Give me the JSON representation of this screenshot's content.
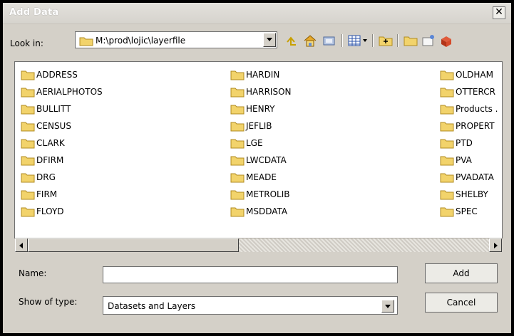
{
  "window": {
    "title": "Add Data",
    "close_glyph": "✕"
  },
  "look_in": {
    "label": "Look in:",
    "path": "M:\\prod\\lojic\\layerfile"
  },
  "toolbar": [
    {
      "name": "up-one-level-icon"
    },
    {
      "name": "home-icon"
    },
    {
      "name": "connect-to-folder-icon"
    },
    {
      "name": "view-menu-icon"
    },
    {
      "name": "new-folder-icon"
    },
    {
      "name": "new-folder-2-icon"
    },
    {
      "name": "new-shapefile-icon"
    },
    {
      "name": "new-toolbox-icon"
    }
  ],
  "files": {
    "col1": [
      "ADDRESS",
      "AERIALPHOTOS",
      "BULLITT",
      "CENSUS",
      "CLARK",
      "DFIRM",
      "DRG",
      "FIRM",
      "FLOYD"
    ],
    "col2": [
      "HARDIN",
      "HARRISON",
      "HENRY",
      "JEFLIB",
      "LGE",
      "LWCDATA",
      "MEADE",
      "METROLIB",
      "MSDDATA"
    ],
    "col3": [
      "OLDHAM",
      "OTTERCR",
      "Products .",
      "PROPERT",
      "PTD",
      "PVA",
      "PVADATA",
      "SHELBY",
      "SPEC"
    ]
  },
  "name": {
    "label": "Name:",
    "value": ""
  },
  "type": {
    "label": "Show of type:",
    "value": "Datasets and Layers"
  },
  "buttons": {
    "add": "Add",
    "cancel": "Cancel"
  },
  "colors": {
    "folder": "#f2d36b",
    "folder_edge": "#b08b20",
    "panel": "#d4d0c8"
  }
}
